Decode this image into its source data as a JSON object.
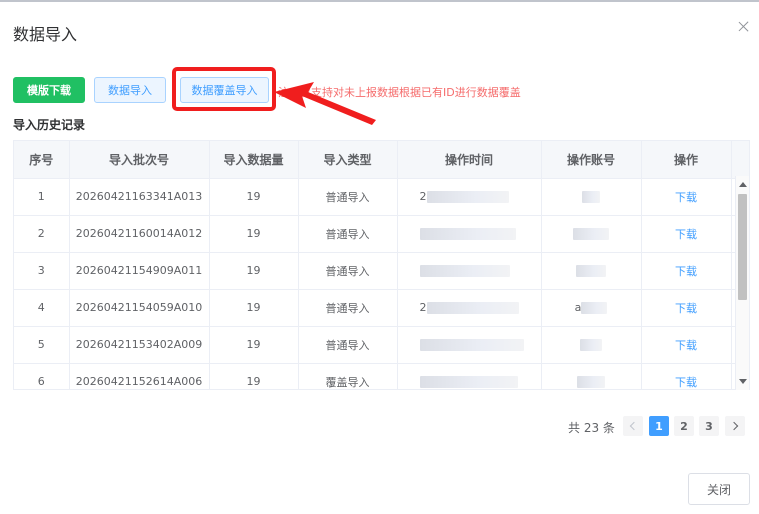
{
  "dialog": {
    "title": "数据导入",
    "close_label": "关闭"
  },
  "toolbar": {
    "template_download": "模版下载",
    "data_import": "数据导入",
    "data_cover_import": "数据覆盖导入",
    "note": "注：仅支持对未上报数据根据已有ID进行数据覆盖"
  },
  "history": {
    "title": "导入历史记录",
    "columns": [
      "序号",
      "导入批次号",
      "导入数据量",
      "导入类型",
      "操作时间",
      "操作账号",
      "操作"
    ],
    "rows": [
      {
        "index": "1",
        "batch": "20260421163341A013",
        "count": "19",
        "type": "普通导入",
        "time_prefix": "2",
        "account_prefix": "",
        "action": "下载"
      },
      {
        "index": "2",
        "batch": "20260421160014A012",
        "count": "19",
        "type": "普通导入",
        "time_prefix": "",
        "account_prefix": "",
        "action": "下载"
      },
      {
        "index": "3",
        "batch": "20260421154909A011",
        "count": "19",
        "type": "普通导入",
        "time_prefix": "",
        "account_prefix": "",
        "action": "下载"
      },
      {
        "index": "4",
        "batch": "20260421154059A010",
        "count": "19",
        "type": "普通导入",
        "time_prefix": "2",
        "account_prefix": "a",
        "action": "下载"
      },
      {
        "index": "5",
        "batch": "20260421153402A009",
        "count": "19",
        "type": "普通导入",
        "time_prefix": "",
        "account_prefix": "",
        "action": "下载"
      },
      {
        "index": "6",
        "batch": "20260421152614A006",
        "count": "19",
        "type": "覆盖导入",
        "time_prefix": "",
        "account_prefix": "",
        "action": "下载"
      }
    ]
  },
  "pagination": {
    "total_text": "共 23 条",
    "pages": [
      "1",
      "2",
      "3"
    ],
    "current": "1"
  },
  "colors": {
    "primary": "#409eff",
    "success": "#20c063",
    "danger": "#f56c6c",
    "highlight": "#f01e1e"
  }
}
